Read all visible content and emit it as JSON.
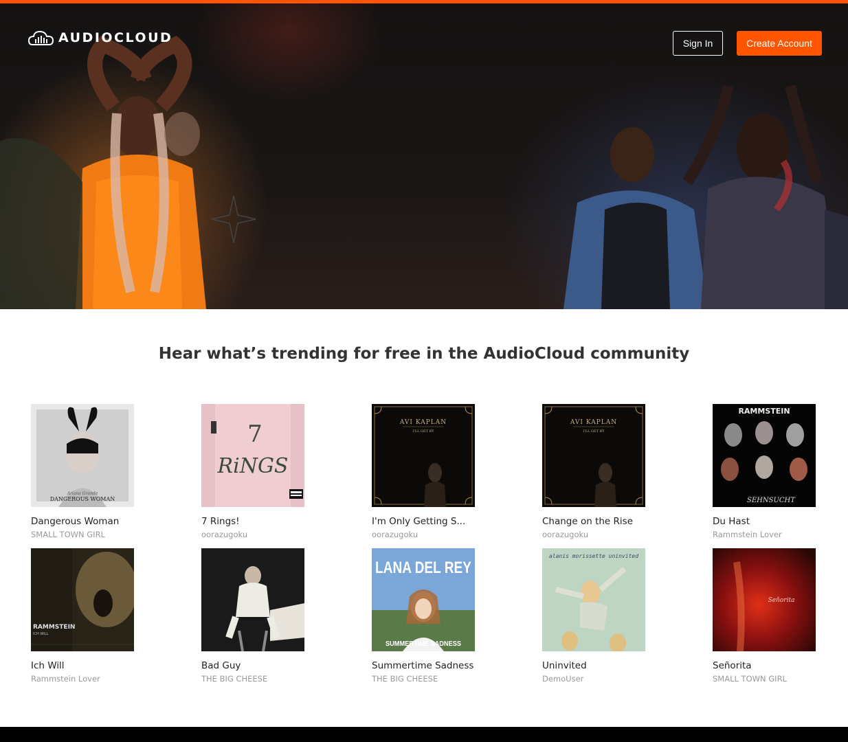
{
  "brand": {
    "name": "AUDIOCLOUD",
    "accent": "#ff5500"
  },
  "header": {
    "sign_in_label": "Sign In",
    "create_account_label": "Create Account"
  },
  "headline": "Hear what’s trending for free in the AudioCloud community",
  "tracks": [
    {
      "title": "Dangerous Woman",
      "user": "SMALL TOWN GIRL",
      "cover_text": "DANGEROUS WOMAN",
      "cover_sub": "Ariana Grande"
    },
    {
      "title": "7 Rings!",
      "user": "oorazugoku",
      "cover_text": "7 RiNGS",
      "cover_sub": "PARENTAL ADVISORY"
    },
    {
      "title": "I'm Only Getting S...",
      "user": "oorazugoku",
      "cover_text": "AVI KAPLAN",
      "cover_sub": "I'LL GET BY"
    },
    {
      "title": "Change on the Rise",
      "user": "oorazugoku",
      "cover_text": "AVI KAPLAN",
      "cover_sub": "I'LL GET BY"
    },
    {
      "title": "Du Hast",
      "user": "Rammstein Lover",
      "cover_text": "RAMMSTEIN",
      "cover_sub": "SEHNSUCHT"
    },
    {
      "title": "Ich Will",
      "user": "Rammstein Lover",
      "cover_text": "RAMMSTEIN",
      "cover_sub": "ICH WILL"
    },
    {
      "title": "Bad Guy",
      "user": "THE BIG CHEESE",
      "cover_text": "",
      "cover_sub": ""
    },
    {
      "title": "Summertime Sadness",
      "user": "THE BIG CHEESE",
      "cover_text": "LANA DEL REY",
      "cover_sub": "SUMMERTIME SADNESS"
    },
    {
      "title": "Uninvited",
      "user": "DemoUser",
      "cover_text": "alanis morissette uninvited",
      "cover_sub": ""
    },
    {
      "title": "Señorita",
      "user": "SMALL TOWN GIRL",
      "cover_text": "Señorita",
      "cover_sub": ""
    }
  ]
}
